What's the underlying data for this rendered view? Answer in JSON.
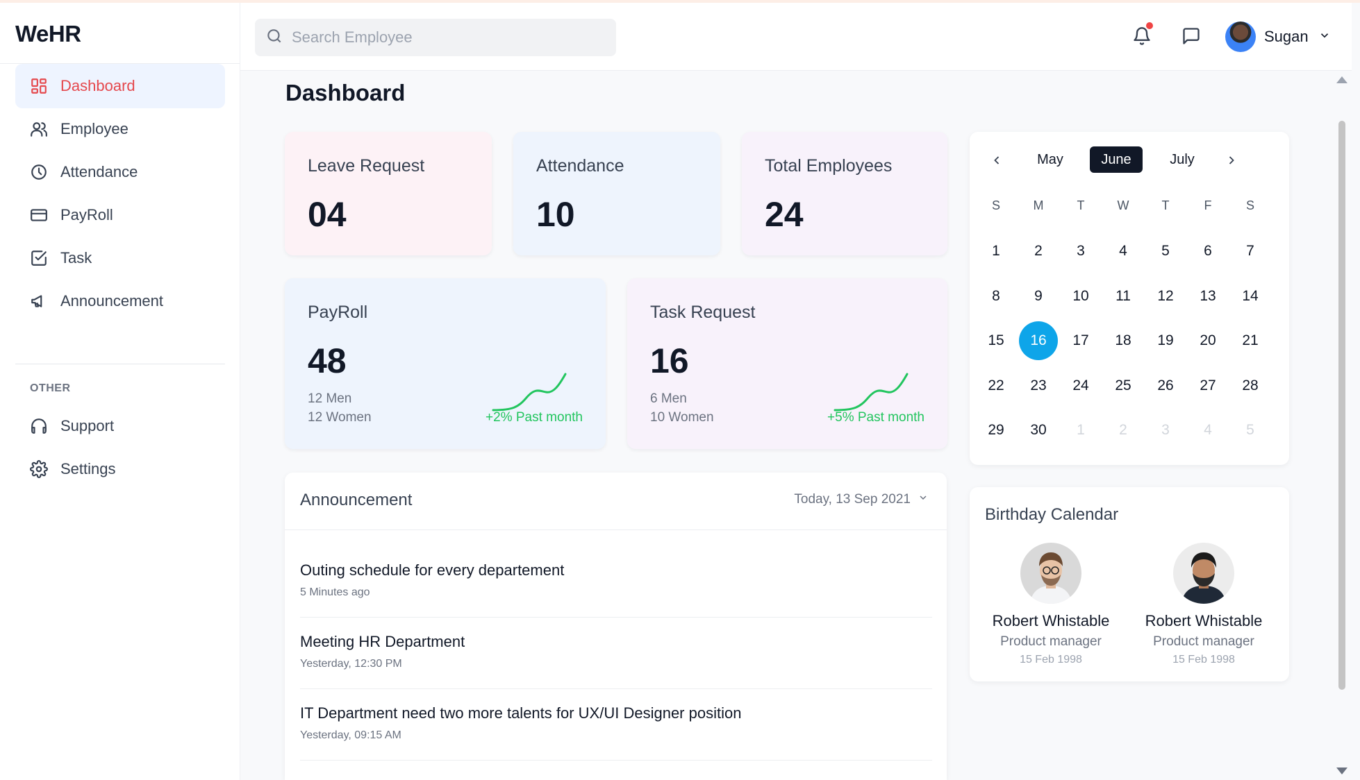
{
  "app": {
    "logo": "WeHR"
  },
  "sidebar": {
    "items": [
      {
        "label": "Dashboard",
        "icon": "grid-icon",
        "active": true
      },
      {
        "label": "Employee",
        "icon": "users-icon"
      },
      {
        "label": "Attendance",
        "icon": "clock-icon"
      },
      {
        "label": "PayRoll",
        "icon": "credit-card-icon"
      },
      {
        "label": "Task",
        "icon": "checkbox-icon"
      },
      {
        "label": "Announcement",
        "icon": "megaphone-icon"
      }
    ],
    "other_label": "OTHER",
    "other_items": [
      {
        "label": "Support",
        "icon": "headphones-icon"
      },
      {
        "label": "Settings",
        "icon": "gear-icon"
      }
    ]
  },
  "header": {
    "search_placeholder": "Search Employee",
    "user_name": "Sugan"
  },
  "page": {
    "title": "Dashboard"
  },
  "stats": {
    "leave": {
      "title": "Leave Request",
      "value": "04"
    },
    "attendance": {
      "title": "Attendance",
      "value": "10"
    },
    "employees": {
      "title": "Total Employees",
      "value": "24"
    },
    "payroll": {
      "title": "PayRoll",
      "value": "48",
      "men": "12 Men",
      "women": "12 Women",
      "trend": "+2% Past month"
    },
    "task": {
      "title": "Task Request",
      "value": "16",
      "men": "6 Men",
      "women": "10 Women",
      "trend": "+5% Past month"
    }
  },
  "calendar": {
    "prev_month": "May",
    "current_month": "June",
    "next_month": "July",
    "weekdays": [
      "S",
      "M",
      "T",
      "W",
      "T",
      "F",
      "S"
    ],
    "weeks": [
      [
        "1",
        "2",
        "3",
        "4",
        "5",
        "6",
        "7"
      ],
      [
        "8",
        "9",
        "10",
        "11",
        "12",
        "13",
        "14"
      ],
      [
        "15",
        "16",
        "17",
        "18",
        "19",
        "20",
        "21"
      ],
      [
        "22",
        "23",
        "24",
        "25",
        "26",
        "27",
        "28"
      ],
      [
        "29",
        "30",
        "1",
        "2",
        "3",
        "4",
        "5"
      ]
    ],
    "selected_day": "16"
  },
  "announcement": {
    "title": "Announcement",
    "date_filter": "Today, 13 Sep 2021",
    "items": [
      {
        "title": "Outing schedule for every departement",
        "time": "5 Minutes ago"
      },
      {
        "title": "Meeting HR Department",
        "time": "Yesterday, 12:30 PM"
      },
      {
        "title": "IT Department need two more talents for UX/UI Designer position",
        "time": "Yesterday, 09:15 AM"
      }
    ]
  },
  "birthday": {
    "title": "Birthday Calendar",
    "people": [
      {
        "name": "Robert Whistable",
        "role": "Product manager",
        "date": "15 Feb 1998"
      },
      {
        "name": "Robert Whistable",
        "role": "Product manager",
        "date": "15 Feb 1998"
      }
    ]
  },
  "colors": {
    "accent_red": "#e5484d",
    "active_bg": "#eef4ff",
    "today_blue": "#0ea5e9",
    "trend_green": "#22c55e",
    "leave_card_bg": "#fdf2f6",
    "attendance_card_bg": "#eef4fd",
    "employees_card_bg": "#f8f2fb",
    "payroll_card_bg": "#eef4fd",
    "task_card_bg": "#f8f2fb"
  }
}
